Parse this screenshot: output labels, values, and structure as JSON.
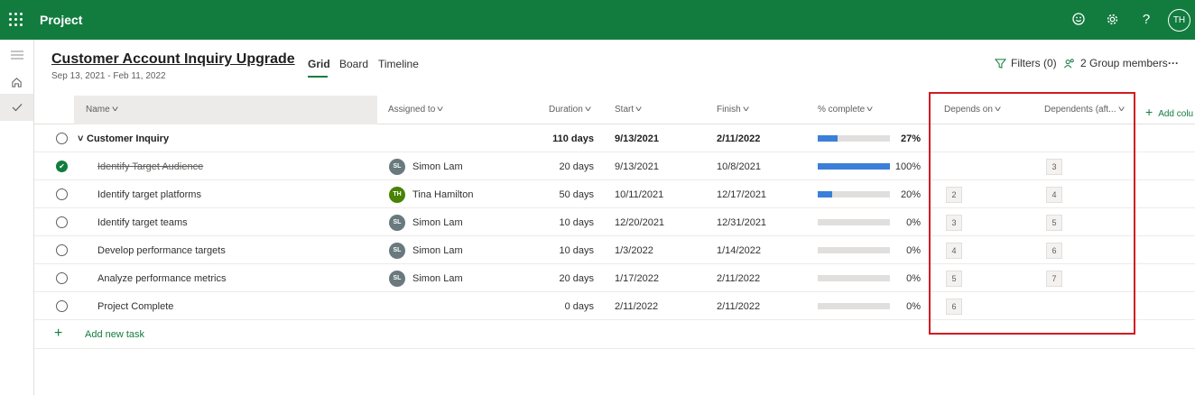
{
  "app": {
    "title": "Project",
    "avatar_initials": "TH"
  },
  "plan": {
    "title": "Customer Account Inquiry Upgrade",
    "dates": "Sep 13, 2021 - Feb 11, 2022"
  },
  "views": [
    "Grid",
    "Board",
    "Timeline"
  ],
  "header_right": {
    "filters": "Filters (0)",
    "members": "2 Group members",
    "more": "···"
  },
  "columns": {
    "name": "Name",
    "assigned": "Assigned to",
    "duration": "Duration",
    "start": "Start",
    "finish": "Finish",
    "complete": "% complete",
    "depends": "Depends on",
    "dependents": "Dependents (aft...",
    "add": "Add colu"
  },
  "summary": {
    "name": "Customer Inquiry",
    "duration": "110 days",
    "start": "9/13/2021",
    "finish": "2/11/2022",
    "complete": "27%",
    "progress": 0.27
  },
  "tasks": [
    {
      "name": "Identify Target Audience",
      "done": true,
      "assignee": "Simon Lam",
      "initials": "SL",
      "duration": "20 days",
      "start": "9/13/2021",
      "finish": "10/8/2021",
      "complete": "100%",
      "progress": 1.0,
      "depends": "",
      "dependents": "3"
    },
    {
      "name": "Identify target platforms",
      "done": false,
      "assignee": "Tina Hamilton",
      "initials": "TH",
      "duration": "50 days",
      "start": "10/11/2021",
      "finish": "12/17/2021",
      "complete": "20%",
      "progress": 0.2,
      "depends": "2",
      "dependents": "4"
    },
    {
      "name": "Identify target teams",
      "done": false,
      "assignee": "Simon Lam",
      "initials": "SL",
      "duration": "10 days",
      "start": "12/20/2021",
      "finish": "12/31/2021",
      "complete": "0%",
      "progress": 0,
      "depends": "3",
      "dependents": "5"
    },
    {
      "name": "Develop performance targets",
      "done": false,
      "assignee": "Simon Lam",
      "initials": "SL",
      "duration": "10 days",
      "start": "1/3/2022",
      "finish": "1/14/2022",
      "complete": "0%",
      "progress": 0,
      "depends": "4",
      "dependents": "6"
    },
    {
      "name": "Analyze performance metrics",
      "done": false,
      "assignee": "Simon Lam",
      "initials": "SL",
      "duration": "20 days",
      "start": "1/17/2022",
      "finish": "2/11/2022",
      "complete": "0%",
      "progress": 0,
      "depends": "5",
      "dependents": "7"
    },
    {
      "name": "Project Complete",
      "done": false,
      "assignee": "",
      "initials": "",
      "duration": "0 days",
      "start": "2/11/2022",
      "finish": "2/11/2022",
      "complete": "0%",
      "progress": 0,
      "depends": "6",
      "dependents": ""
    }
  ],
  "add_task": "Add new task",
  "colors": {
    "brand": "#127c3f",
    "progress": "#3b7fd9",
    "sl_avatar": "#69797e",
    "th_avatar": "#498205",
    "highlight": "#d11b22"
  }
}
